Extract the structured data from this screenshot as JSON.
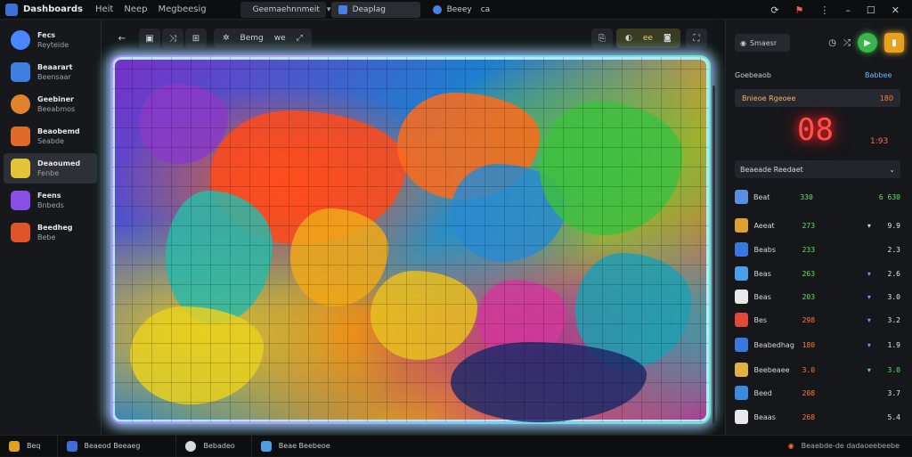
{
  "topbar": {
    "app_title": "Dashboards",
    "menu": [
      "Heit",
      "Neep",
      "Megbeesig"
    ],
    "tabs": [
      {
        "label": "Geemaehnnmeit",
        "active": false
      },
      {
        "label": "Deaplag",
        "active": true
      }
    ],
    "extra_tab": {
      "label": "Beeey",
      "suffix": "ca"
    },
    "window_controls": [
      "refresh-icon",
      "flag-icon",
      "more-icon",
      "minimize-icon",
      "maximize-icon",
      "close-icon"
    ]
  },
  "sidebar": {
    "items": [
      {
        "title": "Fecs",
        "subtitle": "Reyteide",
        "icon_color": "#4c86ff",
        "active": false
      },
      {
        "title": "Beaarart",
        "subtitle": "Beensaar",
        "icon_color": "#3f7fe0",
        "active": false
      },
      {
        "title": "Geebiner",
        "subtitle": "Beeabmos",
        "icon_color": "#e0832c",
        "active": false
      },
      {
        "title": "Beaobemd",
        "subtitle": "Seabde",
        "icon_color": "#e06a2a",
        "active": false
      },
      {
        "title": "Deaoumed",
        "subtitle": "Fenbe",
        "icon_color": "#e5c43a",
        "active": true
      },
      {
        "title": "Feens",
        "subtitle": "Bnbeds",
        "icon_color": "#8a4fe8",
        "active": false
      },
      {
        "title": "Beedheg",
        "subtitle": "Bebe",
        "icon_color": "#e0542a",
        "active": false
      }
    ]
  },
  "toolbar": {
    "back_label": "←",
    "group_label": "Bemg",
    "group_suffix": "we",
    "right_group_label": "ee"
  },
  "right_panel": {
    "search_label": "Smaesr",
    "section_label": "Goebeaob",
    "section_value": "Babbee",
    "timer_label": "Bnieoe Rgeoee",
    "timer_right": "180",
    "timer_big": "08",
    "timer_small": "1:93",
    "leaderboard_label": "Beaeade Reedaet",
    "rows": [
      {
        "name": "Beat",
        "score": "330",
        "score_color": "#5fe35f",
        "arrow": "",
        "value": "6 630",
        "value_color": "#5fe35f",
        "icon_color": "#5a8fe0"
      },
      {
        "name": "Aeeat",
        "score": "273",
        "score_color": "#5fe35f",
        "arrow": "▾",
        "value": "9.9",
        "value_color": "#e4e6ea",
        "icon_color": "#e0a030"
      },
      {
        "name": "Beabs",
        "score": "233",
        "score_color": "#5fe35f",
        "arrow": "",
        "value": "2.3",
        "value_color": "#e4e6ea",
        "icon_color": "#3a78e0"
      },
      {
        "name": "Beas",
        "score": "263",
        "score_color": "#5fe35f",
        "arrow": "▾",
        "value": "2.6",
        "value_color": "#e4e6ea",
        "icon_color": "#4aa0e8"
      },
      {
        "name": "Beas",
        "score": "203",
        "score_color": "#5fe35f",
        "arrow": "▾",
        "value": "3.0",
        "value_color": "#e4e6ea",
        "icon_color": "#e8e8e8"
      },
      {
        "name": "Bes",
        "score": "298",
        "score_color": "#ff7a3a",
        "arrow": "▾",
        "value": "3.2",
        "value_color": "#e4e6ea",
        "icon_color": "#e04a3a"
      },
      {
        "name": "Beabedhag",
        "score": "180",
        "score_color": "#ff7a3a",
        "arrow": "▾",
        "value": "1.9",
        "value_color": "#e4e6ea",
        "icon_color": "#3a78e0"
      },
      {
        "name": "Beebeaee",
        "score": "3.0",
        "score_color": "#ff7a3a",
        "arrow": "▾",
        "value": "3.0",
        "value_color": "#5fe35f",
        "icon_color": "#e0b040"
      },
      {
        "name": "Beed",
        "score": "208",
        "score_color": "#ff7a3a",
        "arrow": "",
        "value": "3.7",
        "value_color": "#e4e6ea",
        "icon_color": "#3a8ae0"
      },
      {
        "name": "Beaas",
        "score": "268",
        "score_color": "#ff7a3a",
        "arrow": "",
        "value": "5.4",
        "value_color": "#e4e6ea",
        "icon_color": "#e8e8e8"
      }
    ]
  },
  "bottombar": {
    "items": [
      {
        "label": "Beq",
        "icon_color": "#e0a020"
      },
      {
        "label": "Beaeod Beeaeg",
        "icon_color": "#3a6fd8"
      },
      {
        "label": "Bebadeo",
        "icon_color": "#d8d8d8"
      },
      {
        "label": "Beae Beebeoe",
        "icon_color": "#4aa0e0"
      }
    ],
    "status_text": "Beaebde-de dadaoeebeebe"
  },
  "colors": {
    "accent": "#4b7fe8",
    "timer_red": "#ff5050",
    "positive": "#5fe35f",
    "warning": "#ff7a3a"
  }
}
